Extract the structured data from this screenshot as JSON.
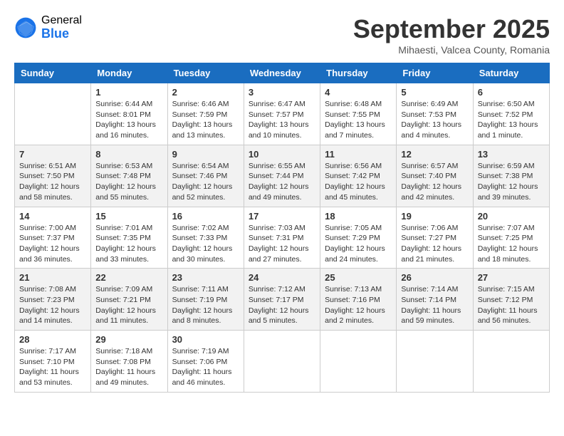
{
  "logo": {
    "general": "General",
    "blue": "Blue"
  },
  "title": "September 2025",
  "location": "Mihaesti, Valcea County, Romania",
  "days_header": [
    "Sunday",
    "Monday",
    "Tuesday",
    "Wednesday",
    "Thursday",
    "Friday",
    "Saturday"
  ],
  "weeks": [
    [
      {
        "day": "",
        "info": ""
      },
      {
        "day": "1",
        "info": "Sunrise: 6:44 AM\nSunset: 8:01 PM\nDaylight: 13 hours\nand 16 minutes."
      },
      {
        "day": "2",
        "info": "Sunrise: 6:46 AM\nSunset: 7:59 PM\nDaylight: 13 hours\nand 13 minutes."
      },
      {
        "day": "3",
        "info": "Sunrise: 6:47 AM\nSunset: 7:57 PM\nDaylight: 13 hours\nand 10 minutes."
      },
      {
        "day": "4",
        "info": "Sunrise: 6:48 AM\nSunset: 7:55 PM\nDaylight: 13 hours\nand 7 minutes."
      },
      {
        "day": "5",
        "info": "Sunrise: 6:49 AM\nSunset: 7:53 PM\nDaylight: 13 hours\nand 4 minutes."
      },
      {
        "day": "6",
        "info": "Sunrise: 6:50 AM\nSunset: 7:52 PM\nDaylight: 13 hours\nand 1 minute."
      }
    ],
    [
      {
        "day": "7",
        "info": "Sunrise: 6:51 AM\nSunset: 7:50 PM\nDaylight: 12 hours\nand 58 minutes."
      },
      {
        "day": "8",
        "info": "Sunrise: 6:53 AM\nSunset: 7:48 PM\nDaylight: 12 hours\nand 55 minutes."
      },
      {
        "day": "9",
        "info": "Sunrise: 6:54 AM\nSunset: 7:46 PM\nDaylight: 12 hours\nand 52 minutes."
      },
      {
        "day": "10",
        "info": "Sunrise: 6:55 AM\nSunset: 7:44 PM\nDaylight: 12 hours\nand 49 minutes."
      },
      {
        "day": "11",
        "info": "Sunrise: 6:56 AM\nSunset: 7:42 PM\nDaylight: 12 hours\nand 45 minutes."
      },
      {
        "day": "12",
        "info": "Sunrise: 6:57 AM\nSunset: 7:40 PM\nDaylight: 12 hours\nand 42 minutes."
      },
      {
        "day": "13",
        "info": "Sunrise: 6:59 AM\nSunset: 7:38 PM\nDaylight: 12 hours\nand 39 minutes."
      }
    ],
    [
      {
        "day": "14",
        "info": "Sunrise: 7:00 AM\nSunset: 7:37 PM\nDaylight: 12 hours\nand 36 minutes."
      },
      {
        "day": "15",
        "info": "Sunrise: 7:01 AM\nSunset: 7:35 PM\nDaylight: 12 hours\nand 33 minutes."
      },
      {
        "day": "16",
        "info": "Sunrise: 7:02 AM\nSunset: 7:33 PM\nDaylight: 12 hours\nand 30 minutes."
      },
      {
        "day": "17",
        "info": "Sunrise: 7:03 AM\nSunset: 7:31 PM\nDaylight: 12 hours\nand 27 minutes."
      },
      {
        "day": "18",
        "info": "Sunrise: 7:05 AM\nSunset: 7:29 PM\nDaylight: 12 hours\nand 24 minutes."
      },
      {
        "day": "19",
        "info": "Sunrise: 7:06 AM\nSunset: 7:27 PM\nDaylight: 12 hours\nand 21 minutes."
      },
      {
        "day": "20",
        "info": "Sunrise: 7:07 AM\nSunset: 7:25 PM\nDaylight: 12 hours\nand 18 minutes."
      }
    ],
    [
      {
        "day": "21",
        "info": "Sunrise: 7:08 AM\nSunset: 7:23 PM\nDaylight: 12 hours\nand 14 minutes."
      },
      {
        "day": "22",
        "info": "Sunrise: 7:09 AM\nSunset: 7:21 PM\nDaylight: 12 hours\nand 11 minutes."
      },
      {
        "day": "23",
        "info": "Sunrise: 7:11 AM\nSunset: 7:19 PM\nDaylight: 12 hours\nand 8 minutes."
      },
      {
        "day": "24",
        "info": "Sunrise: 7:12 AM\nSunset: 7:17 PM\nDaylight: 12 hours\nand 5 minutes."
      },
      {
        "day": "25",
        "info": "Sunrise: 7:13 AM\nSunset: 7:16 PM\nDaylight: 12 hours\nand 2 minutes."
      },
      {
        "day": "26",
        "info": "Sunrise: 7:14 AM\nSunset: 7:14 PM\nDaylight: 11 hours\nand 59 minutes."
      },
      {
        "day": "27",
        "info": "Sunrise: 7:15 AM\nSunset: 7:12 PM\nDaylight: 11 hours\nand 56 minutes."
      }
    ],
    [
      {
        "day": "28",
        "info": "Sunrise: 7:17 AM\nSunset: 7:10 PM\nDaylight: 11 hours\nand 53 minutes."
      },
      {
        "day": "29",
        "info": "Sunrise: 7:18 AM\nSunset: 7:08 PM\nDaylight: 11 hours\nand 49 minutes."
      },
      {
        "day": "30",
        "info": "Sunrise: 7:19 AM\nSunset: 7:06 PM\nDaylight: 11 hours\nand 46 minutes."
      },
      {
        "day": "",
        "info": ""
      },
      {
        "day": "",
        "info": ""
      },
      {
        "day": "",
        "info": ""
      },
      {
        "day": "",
        "info": ""
      }
    ]
  ]
}
